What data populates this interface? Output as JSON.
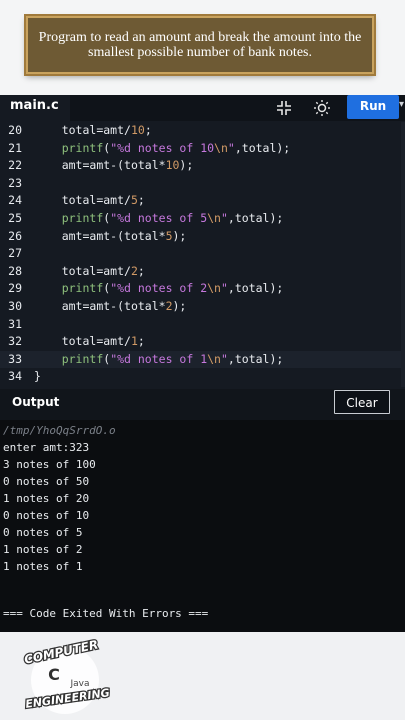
{
  "banner": {
    "text": "Program to read an amount and break the amount into the smallest possible number of bank notes."
  },
  "editor": {
    "file_tab": "main.c",
    "run_label": "Run",
    "lines": [
      {
        "n": "20",
        "tokens": [
          {
            "t": "total=amt/",
            "c": ""
          },
          {
            "t": "10",
            "c": "num"
          },
          {
            "t": ";",
            "c": ""
          }
        ]
      },
      {
        "n": "21",
        "tokens": [
          {
            "t": "printf",
            "c": "fn"
          },
          {
            "t": "(",
            "c": ""
          },
          {
            "t": "\"%d notes of 10",
            "c": "str"
          },
          {
            "t": "\\n",
            "c": "esc"
          },
          {
            "t": "\"",
            "c": "str"
          },
          {
            "t": ",total);",
            "c": ""
          }
        ]
      },
      {
        "n": "22",
        "tokens": [
          {
            "t": "amt=amt-(total*",
            "c": ""
          },
          {
            "t": "10",
            "c": "num"
          },
          {
            "t": ");",
            "c": ""
          }
        ]
      },
      {
        "n": "23",
        "tokens": []
      },
      {
        "n": "24",
        "tokens": [
          {
            "t": "total=amt/",
            "c": ""
          },
          {
            "t": "5",
            "c": "num"
          },
          {
            "t": ";",
            "c": ""
          }
        ]
      },
      {
        "n": "25",
        "tokens": [
          {
            "t": "printf",
            "c": "fn"
          },
          {
            "t": "(",
            "c": ""
          },
          {
            "t": "\"%d notes of 5",
            "c": "str"
          },
          {
            "t": "\\n",
            "c": "esc"
          },
          {
            "t": "\"",
            "c": "str"
          },
          {
            "t": ",total);",
            "c": ""
          }
        ]
      },
      {
        "n": "26",
        "tokens": [
          {
            "t": "amt=amt-(total*",
            "c": ""
          },
          {
            "t": "5",
            "c": "num"
          },
          {
            "t": ");",
            "c": ""
          }
        ]
      },
      {
        "n": "27",
        "tokens": []
      },
      {
        "n": "28",
        "tokens": [
          {
            "t": "total=amt/",
            "c": ""
          },
          {
            "t": "2",
            "c": "num"
          },
          {
            "t": ";",
            "c": ""
          }
        ]
      },
      {
        "n": "29",
        "tokens": [
          {
            "t": "printf",
            "c": "fn"
          },
          {
            "t": "(",
            "c": ""
          },
          {
            "t": "\"%d notes of 2",
            "c": "str"
          },
          {
            "t": "\\n",
            "c": "esc"
          },
          {
            "t": "\"",
            "c": "str"
          },
          {
            "t": ",total);",
            "c": ""
          }
        ]
      },
      {
        "n": "30",
        "tokens": [
          {
            "t": "amt=amt-(total*",
            "c": ""
          },
          {
            "t": "2",
            "c": "num"
          },
          {
            "t": ");",
            "c": ""
          }
        ]
      },
      {
        "n": "31",
        "tokens": []
      },
      {
        "n": "32",
        "tokens": [
          {
            "t": "total=amt/",
            "c": ""
          },
          {
            "t": "1",
            "c": "num"
          },
          {
            "t": ";",
            "c": ""
          }
        ]
      },
      {
        "n": "33",
        "tokens": [
          {
            "t": "printf",
            "c": "fn"
          },
          {
            "t": "(",
            "c": ""
          },
          {
            "t": "\"%d notes of 1",
            "c": "str"
          },
          {
            "t": "\\n",
            "c": "esc"
          },
          {
            "t": "\"",
            "c": "str"
          },
          {
            "t": ",total);",
            "c": ""
          }
        ]
      },
      {
        "n": "34",
        "tokens": [
          {
            "t": "}",
            "c": ""
          }
        ]
      }
    ],
    "current_line": "33"
  },
  "output": {
    "label": "Output",
    "clear_label": "Clear",
    "lines": [
      "/tmp/YhoQqSrrdO.o",
      "enter amt:323",
      "3 notes of 100",
      "0 notes of 50",
      "1 notes of 20",
      "0 notes of 10",
      "0 notes of 5",
      "1 notes of 2",
      "1 notes of 1"
    ],
    "exit_message": "=== Code Exited With Errors ==="
  },
  "logo": {
    "top": "COMPUTER",
    "middle_left": "C",
    "middle_right": "Java",
    "bottom": "ENGINEERING"
  },
  "colors": {
    "run": "#1f6fe0",
    "editor_bg": "#151a22",
    "console_bg": "#0b0d10",
    "banner_bg": "#6e5a34"
  }
}
